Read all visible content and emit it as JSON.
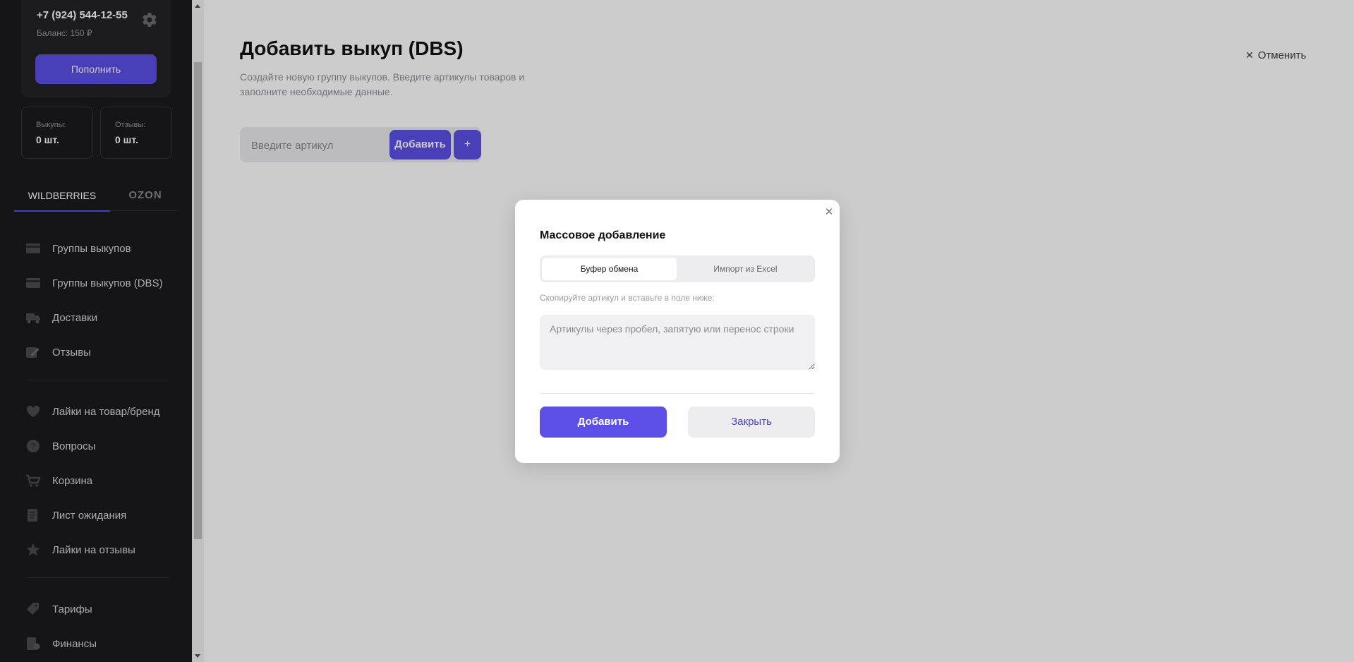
{
  "sidebar": {
    "phone": "+7 (924) 544-12-55",
    "balance": "Баланс: 150 ₽",
    "topup_label": "Пополнить",
    "stats": [
      {
        "label": "Выкупы:",
        "value": "0 шт."
      },
      {
        "label": "Отзывы:",
        "value": "0 шт."
      }
    ],
    "marketplace_tabs": [
      "WILDBERRIES",
      "OZON"
    ],
    "nav": [
      {
        "label": "Группы выкупов",
        "icon": "card-icon"
      },
      {
        "label": "Группы выкупов (DBS)",
        "icon": "card-icon"
      },
      {
        "label": "Доставки",
        "icon": "truck-icon"
      },
      {
        "label": "Отзывы",
        "icon": "edit-icon"
      },
      {
        "label": "Лайки на товар/бренд",
        "icon": "heart-icon"
      },
      {
        "label": "Вопросы",
        "icon": "question-icon"
      },
      {
        "label": "Корзина",
        "icon": "cart-icon"
      },
      {
        "label": "Лист ожидания",
        "icon": "list-icon"
      },
      {
        "label": "Лайки на отзывы",
        "icon": "star-icon"
      },
      {
        "label": "Тарифы",
        "icon": "tag-icon"
      },
      {
        "label": "Финансы",
        "icon": "finance-icon"
      }
    ]
  },
  "main": {
    "title": "Добавить выкуп (DBS)",
    "subtitle": "Создайте новую группу выкупов. Введите артикулы товаров и заполните необходимые данные.",
    "cancel_label": "Отменить",
    "article_placeholder": "Введите артикул",
    "add_label": "Добавить",
    "plus_label": "+"
  },
  "modal": {
    "title": "Массовое добавление",
    "tabs": [
      "Буфер обмена",
      "Импорт из Excel"
    ],
    "hint": "Скопируйте артикул и вставьте в поле ниже:",
    "textarea_placeholder": "Артикулы через пробел, запятую или перенос строки",
    "add_label": "Добавить",
    "close_label": "Закрыть"
  },
  "colors": {
    "accent": "#5b4fe8",
    "sidebar_bg": "#1b1b1d",
    "overlay": "rgba(0,0,0,0.2)"
  }
}
